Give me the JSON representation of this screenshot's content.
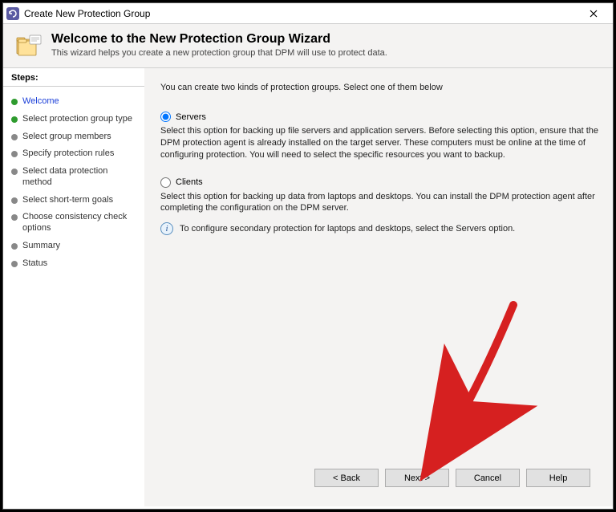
{
  "window": {
    "title": "Create New Protection Group"
  },
  "header": {
    "title": "Welcome to the New Protection Group Wizard",
    "subtitle": "This wizard helps you create a new protection group that DPM will use to protect data."
  },
  "sidebar": {
    "steps_label": "Steps:",
    "items": [
      {
        "label": "Welcome"
      },
      {
        "label": "Select protection group type"
      },
      {
        "label": "Select group members"
      },
      {
        "label": "Specify protection rules"
      },
      {
        "label": "Select data protection method"
      },
      {
        "label": "Select short-term goals"
      },
      {
        "label": "Choose consistency check options"
      },
      {
        "label": "Summary"
      },
      {
        "label": "Status"
      }
    ]
  },
  "main": {
    "intro": "You can create two kinds of protection groups. Select one of them below",
    "options": {
      "servers": {
        "label": "Servers",
        "desc": "Select this option for backing up file servers and application servers. Before selecting this option, ensure that the DPM protection agent is already installed on the target server. These computers must be online at the time of configuring protection. You will need to select the specific resources you want to backup."
      },
      "clients": {
        "label": "Clients",
        "desc": "Select this option for backing up data from laptops and desktops. You can install the DPM protection agent after completing the configuration on the DPM server.",
        "info": "To configure secondary protection for laptops and desktops, select the Servers option."
      }
    }
  },
  "buttons": {
    "back": "< Back",
    "next": "Next >",
    "cancel": "Cancel",
    "help": "Help"
  }
}
